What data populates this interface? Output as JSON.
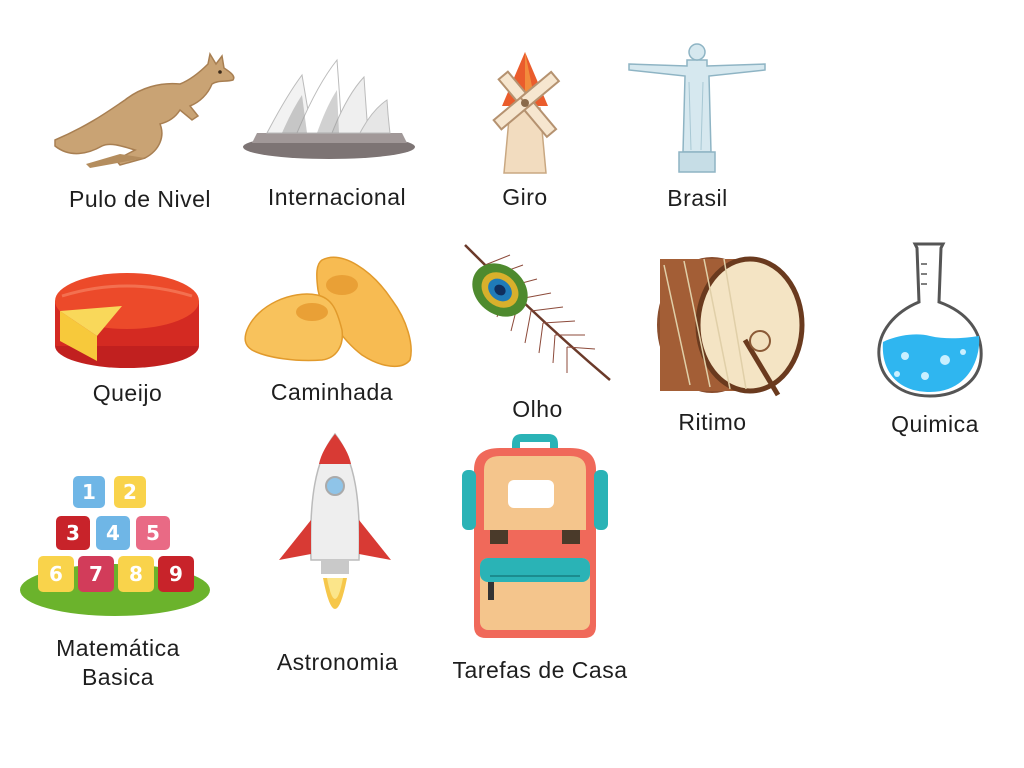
{
  "colors": {
    "background": "#ffffff",
    "label_text": "#1e1e1e"
  },
  "tiles": [
    {
      "label": "Pulo de Nivel",
      "icon": "kangaroo-icon"
    },
    {
      "label": "Internacional",
      "icon": "opera-house-icon"
    },
    {
      "label": "Giro",
      "icon": "windmill-icon"
    },
    {
      "label": "Brasil",
      "icon": "christ-statue-icon"
    },
    {
      "label": "Queijo",
      "icon": "cheese-icon"
    },
    {
      "label": "Caminhada",
      "icon": "clogs-icon"
    },
    {
      "label": "Olho",
      "icon": "peacock-feather-icon"
    },
    {
      "label": "Ritimo",
      "icon": "drum-icon"
    },
    {
      "label": "Quimica",
      "icon": "flask-icon"
    },
    {
      "label": "Matemática",
      "label_line2": "Basica",
      "icon": "number-blocks-icon"
    },
    {
      "label": "Astronomia",
      "icon": "rocket-icon"
    },
    {
      "label": "Tarefas de Casa",
      "icon": "backpack-icon"
    }
  ],
  "number_blocks": [
    "1",
    "2",
    "3",
    "4",
    "5",
    "6",
    "7",
    "8",
    "9"
  ]
}
